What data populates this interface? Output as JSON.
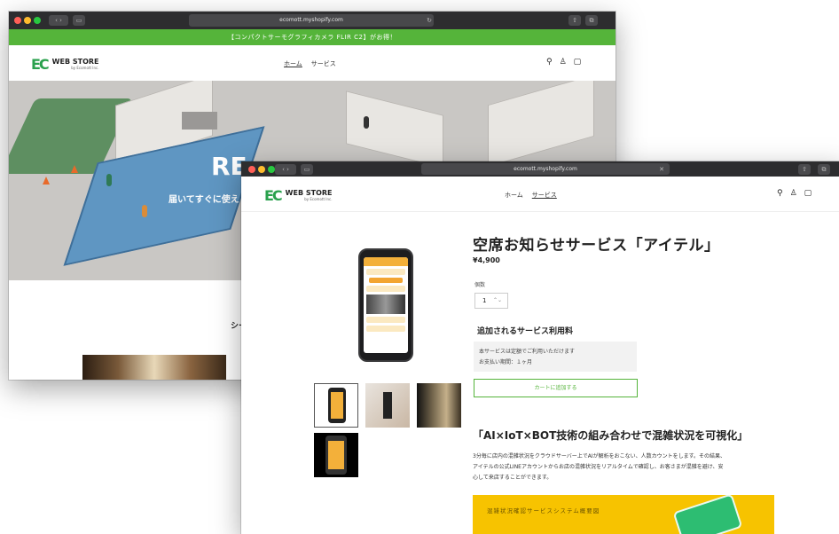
{
  "back_window": {
    "url": "ecomott.myshopify.com",
    "announcement": "【コンパクトサーモグラフィカメラ FLIR C2】がお得！",
    "logo_main": "WEB STORE",
    "logo_sub": "by Ecomott Inc.",
    "logo_mark": "EC",
    "nav": [
      "ホーム",
      "サービス"
    ],
    "hero_heading_partial": "RE",
    "hero_sub_partial": "届いてすぐに使え",
    "section_partial": "シー"
  },
  "front_window": {
    "url": "ecomott.myshopify.com",
    "logo_main": "WEB STORE",
    "logo_sub": "by Ecomott Inc.",
    "logo_mark": "EC",
    "nav": [
      "ホーム",
      "サービス"
    ],
    "product": {
      "title": "空席お知らせサービス「アイテル」",
      "price": "¥4,900",
      "quantity_label": "個数",
      "quantity_value": "1",
      "addon_heading": "追加されるサービス利用料",
      "addon_lines": [
        "本サービスは定額でご利用いただけます",
        "お支払い期間：１ヶ月"
      ],
      "cart_button": "カートに追加する",
      "feature_heading": "「AI×IoT×BOT技術の組み合わせで混雑状況を可視化」",
      "description_lines": [
        "3分毎に店内の混雑状況をクラウドサーバー上でAIが解析をおこない、人数カウントをします。その結果、",
        "アイテルの公式LINEアカウントからお店の混雑状況をリアルタイムで確認し、お客さまが混雑を避け、安",
        "心して来店することができます。"
      ],
      "banner_title": "混雑状況確認サービスシステム概要図"
    }
  },
  "colors": {
    "brand_green": "#55b43a",
    "logo_green": "#2aa14d",
    "banner_yellow": "#f7c300"
  },
  "icons": [
    "search-icon",
    "account-icon",
    "cart-icon",
    "back-icon",
    "forward-icon",
    "sidebar-icon",
    "share-icon",
    "tabs-icon",
    "reload-icon"
  ]
}
